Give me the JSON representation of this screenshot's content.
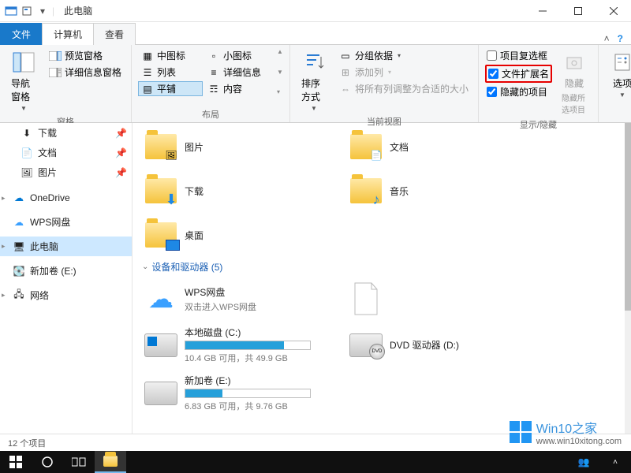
{
  "title": "此电脑",
  "tabs": {
    "file": "文件",
    "computer": "计算机",
    "view": "查看"
  },
  "ribbon": {
    "panes": {
      "label": "窗格",
      "nav": "导航窗格",
      "preview": "预览窗格",
      "details": "详细信息窗格"
    },
    "layout": {
      "label": "布局",
      "medium": "中图标",
      "small": "小图标",
      "list": "列表",
      "detail": "详细信息",
      "tile": "平铺",
      "content": "内容"
    },
    "currentview": {
      "label": "当前视图",
      "sort": "排序方式",
      "group": "分组依据",
      "addcol": "添加列",
      "fitcols": "将所有列调整为合适的大小"
    },
    "showhide": {
      "label": "显示/隐藏",
      "checkboxes": "项目复选框",
      "extensions": "文件扩展名",
      "hiddenitems": "隐藏的项目",
      "hide": "隐藏所选项目",
      "hideshort": "隐藏"
    },
    "options": "选项"
  },
  "nav": {
    "downloads": "下载",
    "documents": "文档",
    "pictures": "图片",
    "onedrive": "OneDrive",
    "wps": "WPS网盘",
    "thispc": "此电脑",
    "newvol": "新加卷 (E:)",
    "network": "网络"
  },
  "folders": {
    "pictures": "图片",
    "documents": "文档",
    "downloads": "下载",
    "music": "音乐",
    "desktop": "桌面"
  },
  "section": {
    "devices": "设备和驱动器 (5)"
  },
  "drives": {
    "wps": {
      "name": "WPS网盘",
      "sub": "双击进入WPS网盘"
    },
    "c": {
      "name": "本地磁盘 (C:)",
      "sub": "10.4 GB 可用，共 49.9 GB",
      "pct": 79
    },
    "e": {
      "name": "新加卷 (E:)",
      "sub": "6.83 GB 可用，共 9.76 GB",
      "pct": 30
    },
    "dvd": {
      "name": "DVD 驱动器 (D:)"
    }
  },
  "status": "12 个项目",
  "watermark": {
    "brand": "Win10之家",
    "url": "www.win10xitong.com"
  }
}
